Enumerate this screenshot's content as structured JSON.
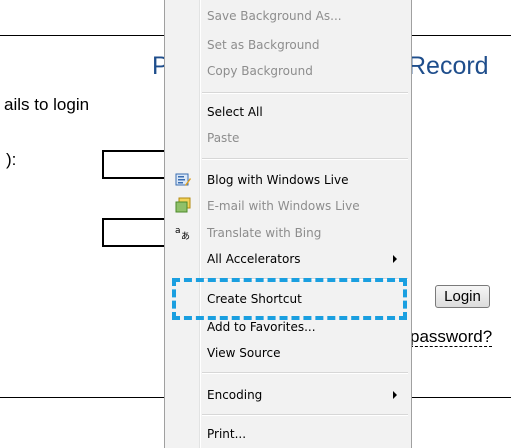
{
  "page": {
    "title_left": "P",
    "title_right": "Record",
    "instruction": "ails to login",
    "field_label": "):",
    "login_button": "Login",
    "forgot_link": "password?"
  },
  "context_menu": {
    "items": [
      {
        "label": "Save Background As...",
        "disabled": true
      },
      {
        "label": "Set as Background",
        "disabled": true
      },
      {
        "label": "Copy Background",
        "disabled": true
      },
      {
        "label": "Select All",
        "disabled": false
      },
      {
        "label": "Paste",
        "disabled": true
      },
      {
        "label": "Blog with Windows Live",
        "disabled": false,
        "icon": "blog-icon"
      },
      {
        "label": "E-mail with Windows Live",
        "disabled": true,
        "icon": "email-icon"
      },
      {
        "label": "Translate with Bing",
        "disabled": true,
        "icon": "translate-icon"
      },
      {
        "label": "All Accelerators",
        "disabled": false,
        "submenu": true
      },
      {
        "label": "Create Shortcut",
        "disabled": false,
        "highlighted": true
      },
      {
        "label": "Add to Favorites...",
        "disabled": false
      },
      {
        "label": "View Source",
        "disabled": false
      },
      {
        "label": "Encoding",
        "disabled": false,
        "submenu": true
      },
      {
        "label": "Print...",
        "disabled": false
      }
    ]
  },
  "colors": {
    "title": "#1f4e8c",
    "highlight": "#1a9fe0",
    "menu_bg": "#f2f2f2",
    "disabled_text": "#8d8d8d"
  }
}
